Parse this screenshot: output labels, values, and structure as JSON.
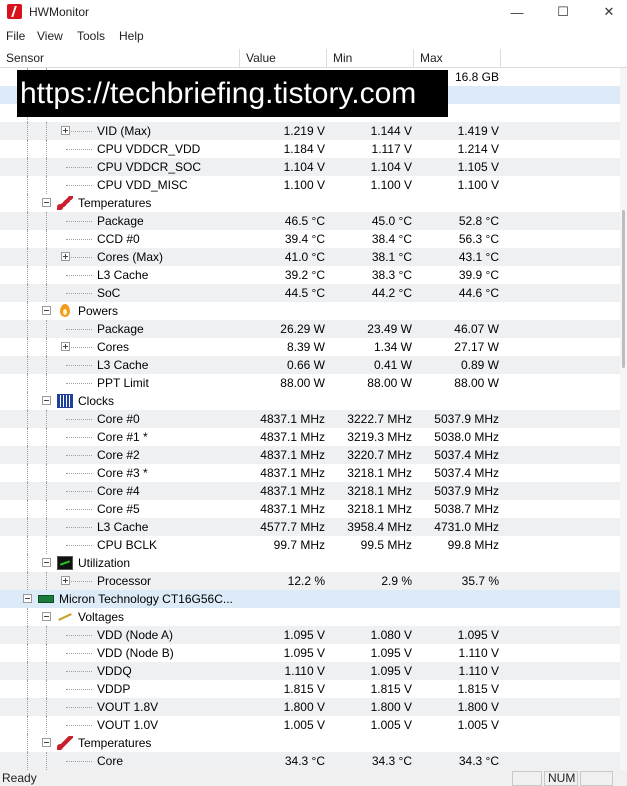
{
  "window": {
    "title": "HWMonitor",
    "minimize_glyph": "—",
    "maximize_glyph": "☐",
    "close_glyph": "✕"
  },
  "menu": [
    "File",
    "View",
    "Tools",
    "Help"
  ],
  "columns": [
    "Sensor",
    "Value",
    "Min",
    "Max"
  ],
  "watermark": "https://techbriefing.tistory.com",
  "rows": [
    {
      "type": "leaf",
      "indent": 2,
      "label": "",
      "value": "",
      "min": "",
      "max": "16.8 GB",
      "alt": false
    },
    {
      "type": "selected",
      "indent": 0,
      "label": "",
      "value": "",
      "min": "",
      "max": "",
      "alt": false
    },
    {
      "type": "group",
      "indent": 1,
      "label": "",
      "icon": "voltage-icon",
      "value": "",
      "min": "",
      "max": "",
      "alt": false
    },
    {
      "type": "leaf",
      "indent": 2,
      "expandable": true,
      "label": "VID (Max)",
      "value": "1.219 V",
      "min": "1.144 V",
      "max": "1.419 V",
      "alt": true
    },
    {
      "type": "leaf",
      "indent": 2,
      "label": "CPU VDDCR_VDD",
      "value": "1.184 V",
      "min": "1.117 V",
      "max": "1.214 V",
      "alt": false
    },
    {
      "type": "leaf",
      "indent": 2,
      "label": "CPU VDDCR_SOC",
      "value": "1.104 V",
      "min": "1.104 V",
      "max": "1.105 V",
      "alt": true
    },
    {
      "type": "leaf",
      "indent": 2,
      "label": "CPU VDD_MISC",
      "value": "1.100 V",
      "min": "1.100 V",
      "max": "1.100 V",
      "alt": false
    },
    {
      "type": "group",
      "indent": 1,
      "label": "Temperatures",
      "icon": "thermometer-icon",
      "value": "",
      "min": "",
      "max": "",
      "alt": false
    },
    {
      "type": "leaf",
      "indent": 2,
      "label": "Package",
      "value": "46.5 °C",
      "min": "45.0 °C",
      "max": "52.8 °C",
      "alt": true
    },
    {
      "type": "leaf",
      "indent": 2,
      "label": "CCD #0",
      "value": "39.4 °C",
      "min": "38.4 °C",
      "max": "56.3 °C",
      "alt": false
    },
    {
      "type": "leaf",
      "indent": 2,
      "expandable": true,
      "label": "Cores (Max)",
      "value": "41.0 °C",
      "min": "38.1 °C",
      "max": "43.1 °C",
      "alt": true
    },
    {
      "type": "leaf",
      "indent": 2,
      "label": "L3 Cache",
      "value": "39.2 °C",
      "min": "38.3 °C",
      "max": "39.9 °C",
      "alt": false
    },
    {
      "type": "leaf",
      "indent": 2,
      "label": "SoC",
      "value": "44.5 °C",
      "min": "44.2 °C",
      "max": "44.6 °C",
      "alt": true
    },
    {
      "type": "group",
      "indent": 1,
      "label": "Powers",
      "icon": "flame-icon",
      "value": "",
      "min": "",
      "max": "",
      "alt": false
    },
    {
      "type": "leaf",
      "indent": 2,
      "label": "Package",
      "value": "26.29 W",
      "min": "23.49 W",
      "max": "46.07 W",
      "alt": true
    },
    {
      "type": "leaf",
      "indent": 2,
      "expandable": true,
      "label": "Cores",
      "value": "8.39 W",
      "min": "1.34 W",
      "max": "27.17 W",
      "alt": false
    },
    {
      "type": "leaf",
      "indent": 2,
      "label": "L3 Cache",
      "value": "0.66 W",
      "min": "0.41 W",
      "max": "0.89 W",
      "alt": true
    },
    {
      "type": "leaf",
      "indent": 2,
      "label": "PPT Limit",
      "value": "88.00 W",
      "min": "88.00 W",
      "max": "88.00 W",
      "alt": false
    },
    {
      "type": "group",
      "indent": 1,
      "label": "Clocks",
      "icon": "clock-icon",
      "value": "",
      "min": "",
      "max": "",
      "alt": false
    },
    {
      "type": "leaf",
      "indent": 2,
      "label": "Core #0",
      "value": "4837.1 MHz",
      "min": "3222.7 MHz",
      "max": "5037.9 MHz",
      "alt": true
    },
    {
      "type": "leaf",
      "indent": 2,
      "label": "Core #1 *",
      "value": "4837.1 MHz",
      "min": "3219.3 MHz",
      "max": "5038.0 MHz",
      "alt": false
    },
    {
      "type": "leaf",
      "indent": 2,
      "label": "Core #2",
      "value": "4837.1 MHz",
      "min": "3220.7 MHz",
      "max": "5037.4 MHz",
      "alt": true
    },
    {
      "type": "leaf",
      "indent": 2,
      "label": "Core #3 *",
      "value": "4837.1 MHz",
      "min": "3218.1 MHz",
      "max": "5037.4 MHz",
      "alt": false
    },
    {
      "type": "leaf",
      "indent": 2,
      "label": "Core #4",
      "value": "4837.1 MHz",
      "min": "3218.1 MHz",
      "max": "5037.9 MHz",
      "alt": true
    },
    {
      "type": "leaf",
      "indent": 2,
      "label": "Core #5",
      "value": "4837.1 MHz",
      "min": "3218.1 MHz",
      "max": "5038.7 MHz",
      "alt": false
    },
    {
      "type": "leaf",
      "indent": 2,
      "label": "L3 Cache",
      "value": "4577.7 MHz",
      "min": "3958.4 MHz",
      "max": "4731.0 MHz",
      "alt": true
    },
    {
      "type": "leaf",
      "indent": 2,
      "label": "CPU BCLK",
      "value": "99.7 MHz",
      "min": "99.5 MHz",
      "max": "99.8 MHz",
      "alt": false
    },
    {
      "type": "group",
      "indent": 1,
      "label": "Utilization",
      "icon": "utilization-icon",
      "value": "",
      "min": "",
      "max": "",
      "alt": false
    },
    {
      "type": "leaf",
      "indent": 2,
      "expandable": true,
      "label": "Processor",
      "value": "12.2 %",
      "min": "2.9 %",
      "max": "35.7 %",
      "alt": true
    },
    {
      "type": "device",
      "indent": 0,
      "label": "Micron Technology CT16G56C...",
      "icon": "ram-icon",
      "value": "",
      "min": "",
      "max": "",
      "alt": false
    },
    {
      "type": "group",
      "indent": 1,
      "label": "Voltages",
      "icon": "voltage-icon",
      "value": "",
      "min": "",
      "max": "",
      "alt": false
    },
    {
      "type": "leaf",
      "indent": 2,
      "label": "VDD (Node A)",
      "value": "1.095 V",
      "min": "1.080 V",
      "max": "1.095 V",
      "alt": true
    },
    {
      "type": "leaf",
      "indent": 2,
      "label": "VDD (Node B)",
      "value": "1.095 V",
      "min": "1.095 V",
      "max": "1.110 V",
      "alt": false
    },
    {
      "type": "leaf",
      "indent": 2,
      "label": "VDDQ",
      "value": "1.110 V",
      "min": "1.095 V",
      "max": "1.110 V",
      "alt": true
    },
    {
      "type": "leaf",
      "indent": 2,
      "label": "VDDP",
      "value": "1.815 V",
      "min": "1.815 V",
      "max": "1.815 V",
      "alt": false
    },
    {
      "type": "leaf",
      "indent": 2,
      "label": "VOUT 1.8V",
      "value": "1.800 V",
      "min": "1.800 V",
      "max": "1.800 V",
      "alt": true
    },
    {
      "type": "leaf",
      "indent": 2,
      "label": "VOUT 1.0V",
      "value": "1.005 V",
      "min": "1.005 V",
      "max": "1.005 V",
      "alt": false
    },
    {
      "type": "group",
      "indent": 1,
      "label": "Temperatures",
      "icon": "thermometer-icon",
      "value": "",
      "min": "",
      "max": "",
      "alt": false
    },
    {
      "type": "leaf",
      "indent": 2,
      "label": "Core",
      "value": "34.3 °C",
      "min": "34.3 °C",
      "max": "34.3 °C",
      "alt": true
    }
  ],
  "status": {
    "text": "Ready",
    "cells": [
      "",
      "NUM",
      ""
    ]
  }
}
